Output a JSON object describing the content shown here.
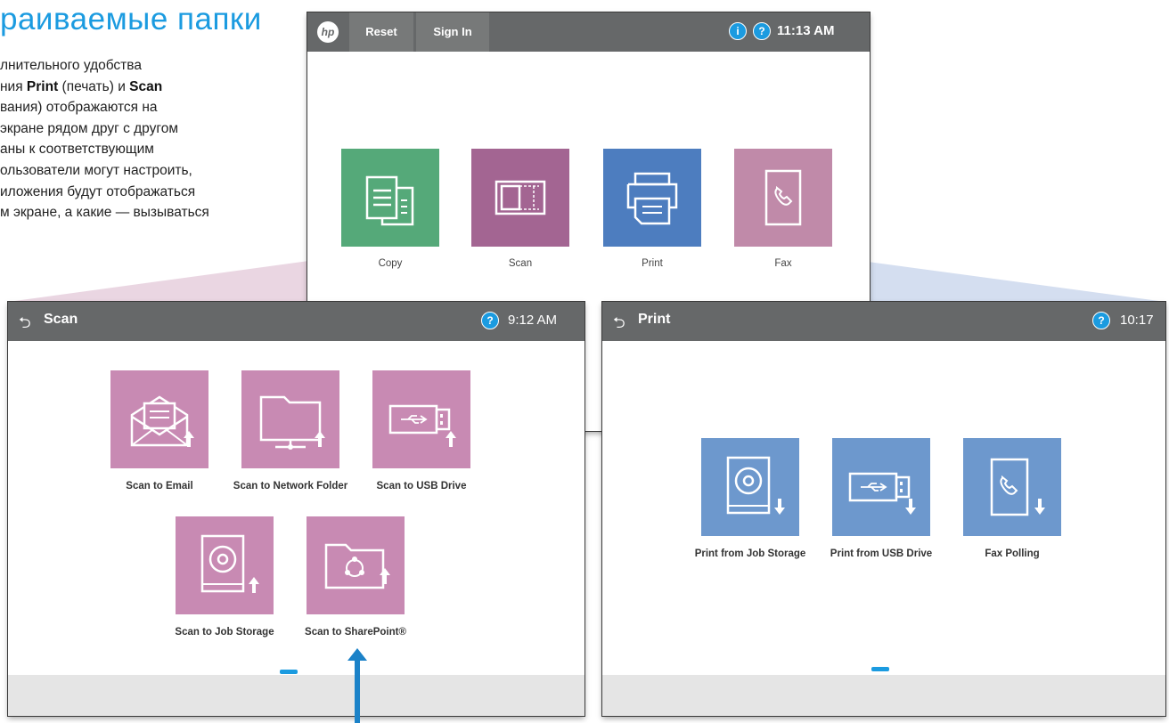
{
  "intro": {
    "title": "раиваемые папки",
    "line1": "лнительного удобства",
    "line2_a": "ния ",
    "line2_print": "Print",
    "line2_b": " (печать) и ",
    "line2_scan": "Scan",
    "line3": "вания) отображаются на",
    "line4": "экране рядом друг с другом",
    "line5": "аны к соответствующим",
    "line6": "ользователи могут настроить,",
    "line7": "иложения будут отображаться",
    "line8": "м экране, а какие — вызываться"
  },
  "home": {
    "logo": "hp",
    "reset": "Reset",
    "sign_in": "Sign In",
    "info_glyph": "i",
    "help_glyph": "?",
    "time": "11:13 AM",
    "tiles": [
      {
        "label": "Copy",
        "color": "#55a979",
        "icon": "copy-icon"
      },
      {
        "label": "Scan",
        "color": "#a36592",
        "icon": "scan-icon"
      },
      {
        "label": "Print",
        "color": "#4d7dbf",
        "icon": "print-icon"
      },
      {
        "label": "Fax",
        "color": "#c08aa9",
        "icon": "fax-icon"
      }
    ]
  },
  "scan_screen": {
    "back_glyph": "⮌",
    "title": "Scan",
    "help_glyph": "?",
    "time": "9:12 AM",
    "tile_color": "#c88ab3",
    "tiles": [
      {
        "label": "Scan to Email",
        "icon": "email-icon"
      },
      {
        "label": "Scan to Network Folder",
        "icon": "network-folder-icon"
      },
      {
        "label": "Scan to USB Drive",
        "icon": "usb-drive-icon"
      },
      {
        "label": "Scan to Job Storage",
        "icon": "job-storage-icon"
      },
      {
        "label": "Scan to SharePoint®",
        "icon": "sharepoint-icon"
      }
    ]
  },
  "print_screen": {
    "back_glyph": "⮌",
    "title": "Print",
    "help_glyph": "?",
    "time": "10:17",
    "tile_color": "#6d98cd",
    "tiles": [
      {
        "label": "Print from Job Storage",
        "icon": "job-storage-icon"
      },
      {
        "label": "Print from USB Drive",
        "icon": "usb-drive-icon"
      },
      {
        "label": "Fax Polling",
        "icon": "fax-polling-icon"
      }
    ]
  },
  "colors": {
    "accent": "#1b9be0",
    "bar": "#666869",
    "footer": "#e5e5e5"
  }
}
